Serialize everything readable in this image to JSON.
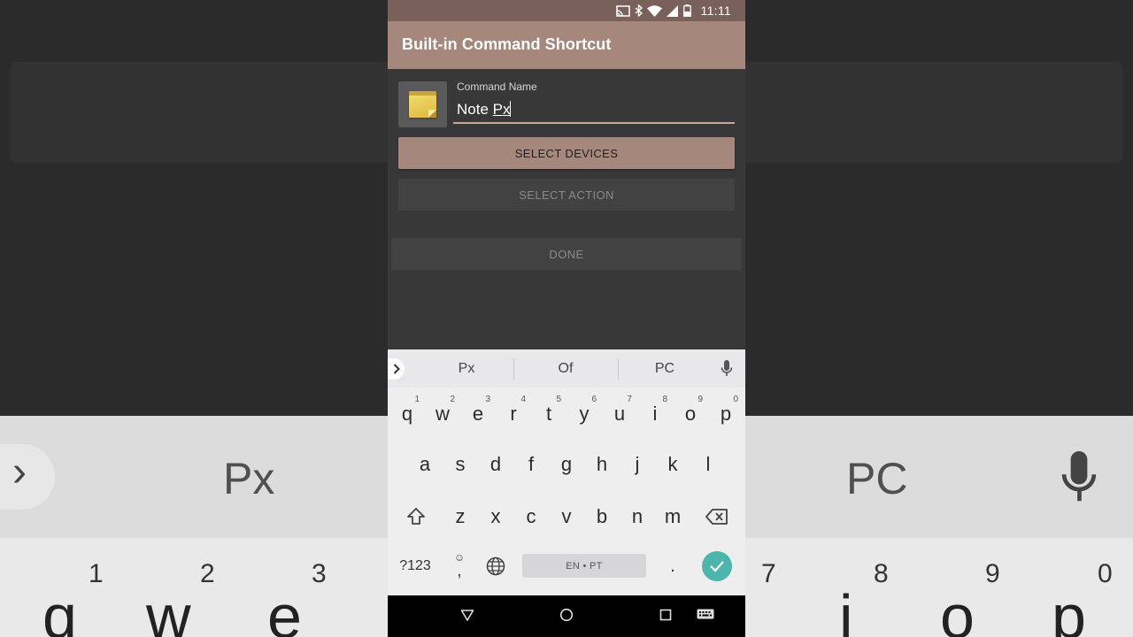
{
  "status_bar": {
    "time": "11:11"
  },
  "app_bar": {
    "title": "Built-in Command Shortcut"
  },
  "command_name": {
    "label": "Command Name",
    "value_plain": "Note ",
    "value_composing": "Px"
  },
  "buttons": {
    "select_devices": "SELECT DEVICES",
    "select_action": "SELECT ACTION",
    "done": "DONE"
  },
  "keyboard": {
    "suggestions": [
      "Px",
      "Of",
      "PC"
    ],
    "row1": [
      "q",
      "w",
      "e",
      "r",
      "t",
      "y",
      "u",
      "i",
      "o",
      "p"
    ],
    "row1_hints": [
      "1",
      "2",
      "3",
      "4",
      "5",
      "6",
      "7",
      "8",
      "9",
      "0"
    ],
    "row2": [
      "a",
      "s",
      "d",
      "f",
      "g",
      "h",
      "j",
      "k",
      "l"
    ],
    "row3": [
      "z",
      "x",
      "c",
      "v",
      "b",
      "n",
      "m"
    ],
    "symbols_key": "?123",
    "comma_key": ",",
    "period_key": ".",
    "emoji_hint": "☺",
    "space_label": "EN • PT",
    "accent_color": "#4db6ac"
  },
  "colors": {
    "app_bar": "#a6877c",
    "status_bar": "#7a605a",
    "primary_button": "#a6877c"
  }
}
